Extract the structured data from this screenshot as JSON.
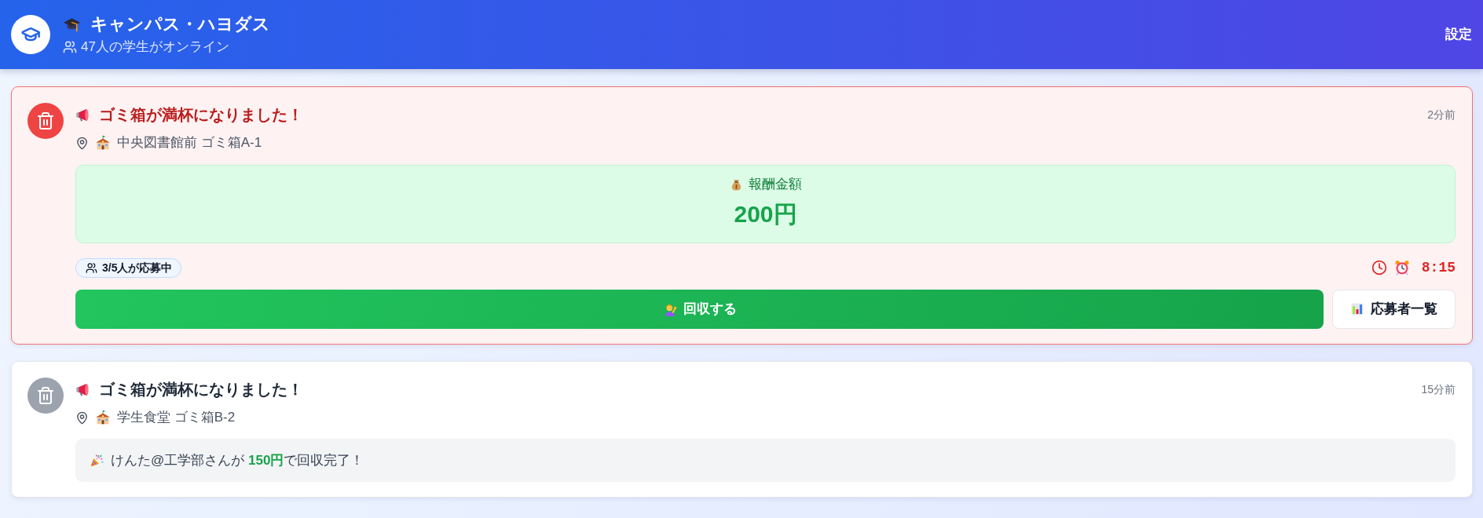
{
  "header": {
    "title": "キャンパス・ハヨダス",
    "online": "47人の学生がオンライン",
    "settings": "設定"
  },
  "alerts": [
    {
      "kind": "urgent",
      "title": "ゴミ箱が満杯になりました！",
      "time": "2分前",
      "location": "中央図書館前 ゴミ箱A-1",
      "reward": {
        "label": "報酬金額",
        "amount": "200円"
      },
      "applicants": "3/5人が応募中",
      "countdown": "8:15",
      "actions": [
        {
          "kind": "primary",
          "label": "回収する"
        },
        {
          "kind": "secondary",
          "label": "応募者一覧"
        }
      ]
    },
    {
      "kind": "done",
      "title": "ゴミ箱が満杯になりました！",
      "time": "15分前",
      "location": "学生食堂 ゴミ箱B-2",
      "result": "けんた@工学部さんが **150円**で回収完了！"
    }
  ]
}
